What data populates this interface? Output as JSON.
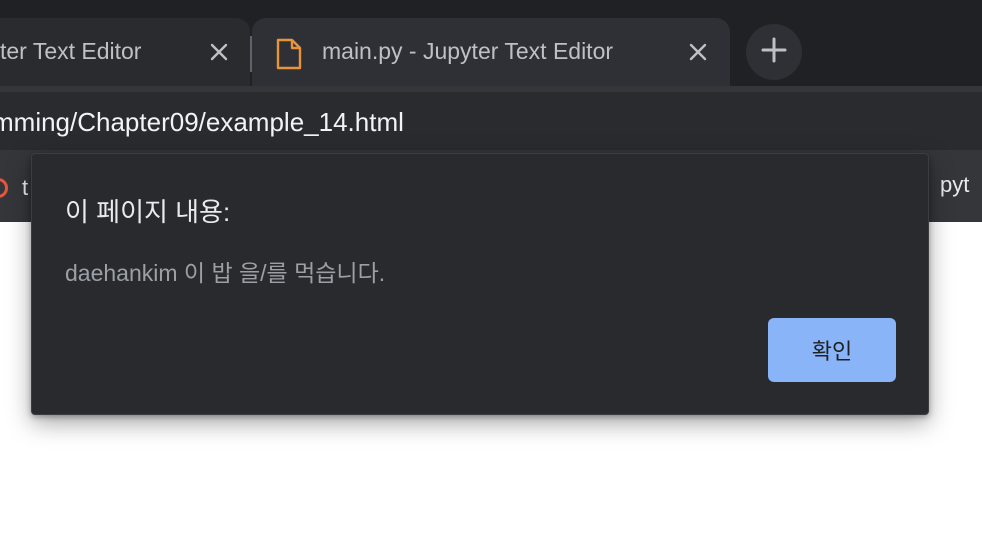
{
  "browser": {
    "tabs": [
      {
        "title": "ter Text Editor",
        "active": false
      },
      {
        "title": "main.py - Jupyter Text Editor",
        "active": true
      }
    ],
    "address_bar": {
      "url": "mming/Chapter09/example_14.html"
    },
    "bookmarks": {
      "left_label": "t",
      "right_label": "pyt"
    }
  },
  "dialog": {
    "title": "이 페이지 내용:",
    "message": "daehankim 이 밥 을/를 먹습니다.",
    "ok_label": "확인"
  },
  "icons": {
    "tab_close": "close-icon",
    "file": "file-icon",
    "new_tab": "plus-icon"
  },
  "colors": {
    "tabstrip_bg": "#202124",
    "dialog_bg": "#292a2e",
    "accent_button": "#8ab4f8",
    "file_icon": "#e8943a"
  }
}
